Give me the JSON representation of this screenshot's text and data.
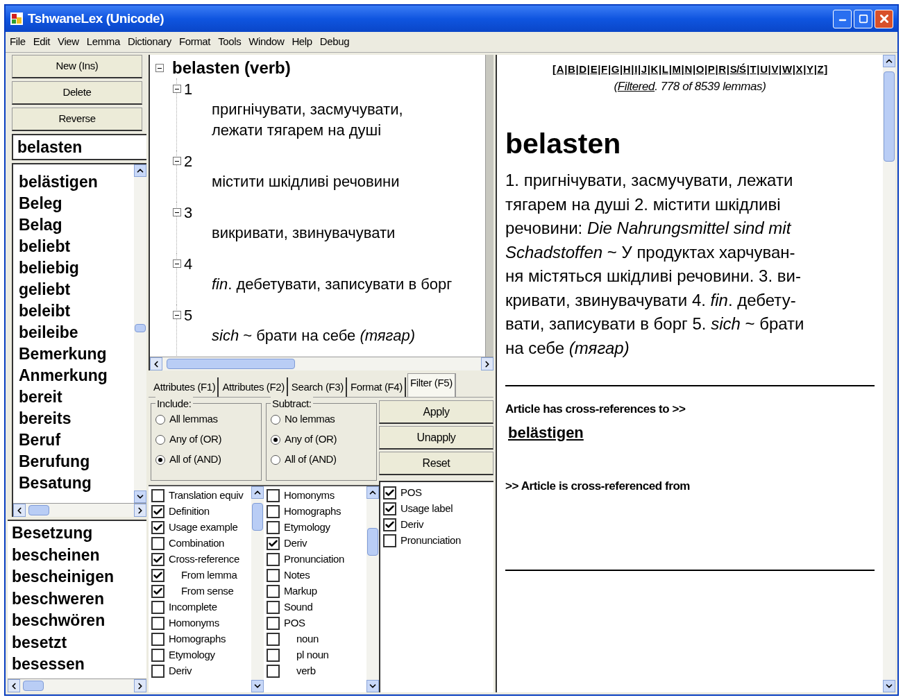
{
  "window": {
    "title": "TshwaneLex (Unicode)"
  },
  "menu": [
    "File",
    "Edit",
    "View",
    "Lemma",
    "Dictionary",
    "Format",
    "Tools",
    "Window",
    "Help",
    "Debug"
  ],
  "lemma_panel": {
    "buttons": [
      "New (Ins)",
      "Delete",
      "Reverse"
    ],
    "search": {
      "value": "belasten"
    },
    "list": [
      "belästigen",
      "Beleg",
      "Belag",
      "beliebt",
      "beliebig",
      "geliebt",
      "beleibt",
      "beileibe",
      "Bemerkung",
      "Anmerkung",
      "bereit",
      "bereits",
      "Beruf",
      "Berufung",
      "Besatung"
    ],
    "list_2": [
      "Besetzung",
      "bescheinen",
      "bescheinigen",
      "beschweren",
      "beschwören",
      "besetzt",
      "besessen"
    ]
  },
  "tree": {
    "root": "belasten (verb)",
    "expanded": true,
    "senses": [
      {
        "number": "1",
        "expanded": true,
        "lines": [
          "пригнічувати, засмучувати,",
          "лежати тягарем на душі"
        ]
      },
      {
        "number": "2",
        "expanded": true,
        "lines": [
          "містити шкідливі речовини"
        ]
      },
      {
        "number": "3",
        "expanded": true,
        "lines": [
          "викривати, звинувачувати"
        ]
      },
      {
        "number": "4",
        "expanded": true,
        "lines": [
          "*fin*. дебетувати, записувати в борг"
        ]
      },
      {
        "number": "5",
        "expanded": true,
        "lines": [
          "*sich* ~ брати на себе *(тягар)*"
        ]
      }
    ]
  },
  "tabs": [
    {
      "label": "Attributes (F1)",
      "selected": false
    },
    {
      "label": "Attributes (F2)",
      "selected": false
    },
    {
      "label": "Search (F3)",
      "selected": false
    },
    {
      "label": "Format (F4)",
      "selected": false
    },
    {
      "label": "Filter (F5)",
      "selected": true
    }
  ],
  "filter": {
    "include": {
      "title": "Include:",
      "options": [
        {
          "label": "All lemmas",
          "selected": false
        },
        {
          "label": "Any of (OR)",
          "selected": false
        },
        {
          "label": "All of (AND)",
          "selected": true
        }
      ]
    },
    "subtract": {
      "title": "Subtract:",
      "options": [
        {
          "label": "No lemmas",
          "selected": false
        },
        {
          "label": "Any of (OR)",
          "selected": true
        },
        {
          "label": "All of (AND)",
          "selected": false
        }
      ]
    },
    "buttons": [
      "Apply",
      "Unapply",
      "Reset"
    ],
    "include_items": [
      {
        "label": "Translation equiv",
        "checked": false
      },
      {
        "label": "Definition",
        "checked": true
      },
      {
        "label": "Usage example",
        "checked": true
      },
      {
        "label": "Combination",
        "checked": false
      },
      {
        "label": "Cross-reference",
        "checked": true,
        "children": [
          {
            "label": "From lemma",
            "checked": true
          },
          {
            "label": "From sense",
            "checked": true
          }
        ]
      },
      {
        "label": "Incomplete",
        "checked": false
      },
      {
        "label": "Homonyms",
        "checked": false
      },
      {
        "label": "Homographs",
        "checked": false
      },
      {
        "label": "Etymology",
        "checked": false
      },
      {
        "label": "Deriv",
        "checked": false
      }
    ],
    "subtract_items": [
      {
        "label": "Homonyms",
        "checked": false
      },
      {
        "label": "Homographs",
        "checked": false
      },
      {
        "label": "Etymology",
        "checked": false
      },
      {
        "label": "Deriv",
        "checked": true
      },
      {
        "label": "Pronunciation",
        "checked": false
      },
      {
        "label": "Notes",
        "checked": false
      },
      {
        "label": "Markup",
        "checked": false
      },
      {
        "label": "Sound",
        "checked": false
      },
      {
        "label": "POS",
        "checked": false,
        "children": [
          {
            "label": "noun",
            "checked": false
          },
          {
            "label": "pl noun",
            "checked": false
          },
          {
            "label": "verb",
            "checked": false
          }
        ]
      }
    ],
    "display_items": [
      {
        "label": "POS",
        "checked": true
      },
      {
        "label": "Usage label",
        "checked": true
      },
      {
        "label": "Deriv",
        "checked": true
      },
      {
        "label": "Pronunciation",
        "checked": false
      }
    ]
  },
  "preview": {
    "alphabet": {
      "open": "[",
      "close": "]",
      "separator": "|",
      "letters": [
        "A",
        "B",
        "D",
        "E",
        "F",
        "G",
        "H",
        "I",
        "J",
        "K",
        "L",
        "M",
        "N",
        "O",
        "P",
        "R",
        "S/Ś",
        "T",
        "U",
        "V",
        "W",
        "X",
        "Y",
        "Z"
      ]
    },
    "filter_status": {
      "open": "(",
      "link": "Filtered",
      "rest": ". 778 of 8539 lemmas)"
    },
    "headword": "belasten",
    "definition_lines": [
      "1. пригнічувати, засмучувати, лежати",
      "тягарем на душі 2. містити шкідливі",
      "речовини: *Die Nahrungsmittel sind mit*",
      "*Schadstoffen* ~ У продуктах харчуван-",
      "ня містяться шкідливі речовини. 3. ви-",
      "кривати, звинувачувати 4. *fin*. дебету-",
      "вати, записувати в борг 5. *sich* ~ брати",
      "на себе *(тягар)*"
    ],
    "xref_to_heading": "Article has cross-references to >>",
    "xref_to": [
      "belästigen"
    ],
    "xref_from_heading": ">> Article is cross-referenced from"
  }
}
